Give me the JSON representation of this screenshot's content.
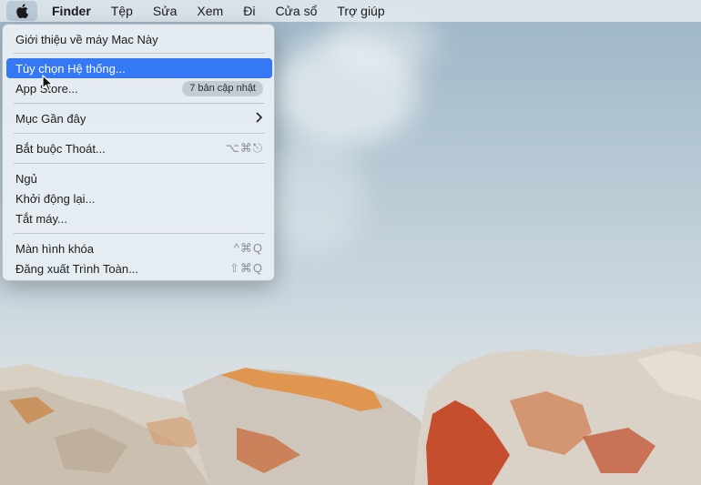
{
  "menubar": {
    "apple_icon": "apple-logo-icon",
    "items": [
      "Finder",
      "Tệp",
      "Sửa",
      "Xem",
      "Đi",
      "Cửa sổ",
      "Trợ giúp"
    ]
  },
  "apple_menu": {
    "about": "Giới thiệu về máy Mac Này",
    "system_prefs": "Tùy chọn Hệ thống...",
    "app_store": "App Store...",
    "app_store_badge": "7 bản cập nhật",
    "recent_items": "Mục Gần đây",
    "force_quit": "Bắt buộc Thoát...",
    "force_quit_shortcut": "⌥⌘⎋",
    "sleep": "Ngủ",
    "restart": "Khởi động lại...",
    "shutdown": "Tắt máy...",
    "lock_screen": "Màn hình khóa",
    "lock_screen_shortcut": "^⌘Q",
    "logout": "Đăng xuất Trình Toàn...",
    "logout_shortcut": "⇧⌘Q",
    "highlight_color": "#3478f6"
  }
}
